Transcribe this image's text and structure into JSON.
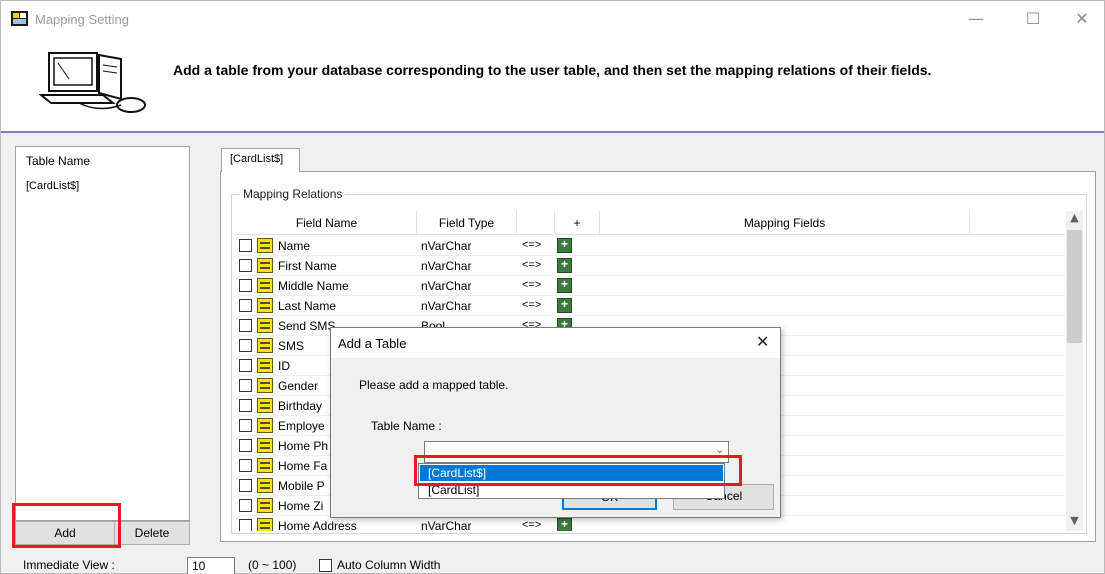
{
  "window": {
    "title": "Mapping Setting",
    "minimize": "—",
    "maximize": "☐",
    "close": "✕"
  },
  "header": {
    "instruction": "Add a table from your database corresponding to the user table, and then set the mapping relations of their fields."
  },
  "left_panel": {
    "header": "Table Name",
    "items": [
      "[CardList$]"
    ],
    "add_label": "Add",
    "delete_label": "Delete"
  },
  "tab": {
    "label": "[CardList$]"
  },
  "mapping": {
    "group_label": "Mapping Relations",
    "columns": [
      "Field Name",
      "Field Type",
      "",
      "+",
      "Mapping Fields"
    ],
    "rows": [
      {
        "name": "Name",
        "type": "nVarChar",
        "op": "<=>"
      },
      {
        "name": "First Name",
        "type": "nVarChar",
        "op": "<=>"
      },
      {
        "name": "Middle Name",
        "type": "nVarChar",
        "op": "<=>"
      },
      {
        "name": "Last Name",
        "type": "nVarChar",
        "op": "<=>"
      },
      {
        "name": "Send SMS",
        "type": "Bool",
        "op": "<=>"
      },
      {
        "name": "SMS",
        "type": "",
        "op": ""
      },
      {
        "name": "ID",
        "type": "",
        "op": ""
      },
      {
        "name": "Gender",
        "type": "",
        "op": ""
      },
      {
        "name": "Birthday",
        "type": "",
        "op": ""
      },
      {
        "name": "Employe",
        "type": "",
        "op": ""
      },
      {
        "name": "Home Ph",
        "type": "",
        "op": ""
      },
      {
        "name": "Home Fa",
        "type": "",
        "op": ""
      },
      {
        "name": "Mobile P",
        "type": "",
        "op": ""
      },
      {
        "name": "Home Zi",
        "type": "",
        "op": ""
      },
      {
        "name": "Home Address",
        "type": "nVarChar",
        "op": "<=>"
      }
    ]
  },
  "bottom": {
    "immediate_view_label": "Immediate View :",
    "immediate_view_value": "10",
    "range_label": "(0 ~ 100)",
    "auto_width_label": "Auto Column Width"
  },
  "dialog": {
    "title": "Add a Table",
    "close": "✕",
    "message": "Please add a mapped table.",
    "table_name_label": "Table Name :",
    "options": [
      "[CardList$]",
      "[CardList]"
    ],
    "ok_label": "OK",
    "cancel_label": "Cancel"
  },
  "colors": {
    "highlight_red": "#e81a1a",
    "selection_blue": "#0078d7",
    "header_rule": "#7f7fc8"
  }
}
